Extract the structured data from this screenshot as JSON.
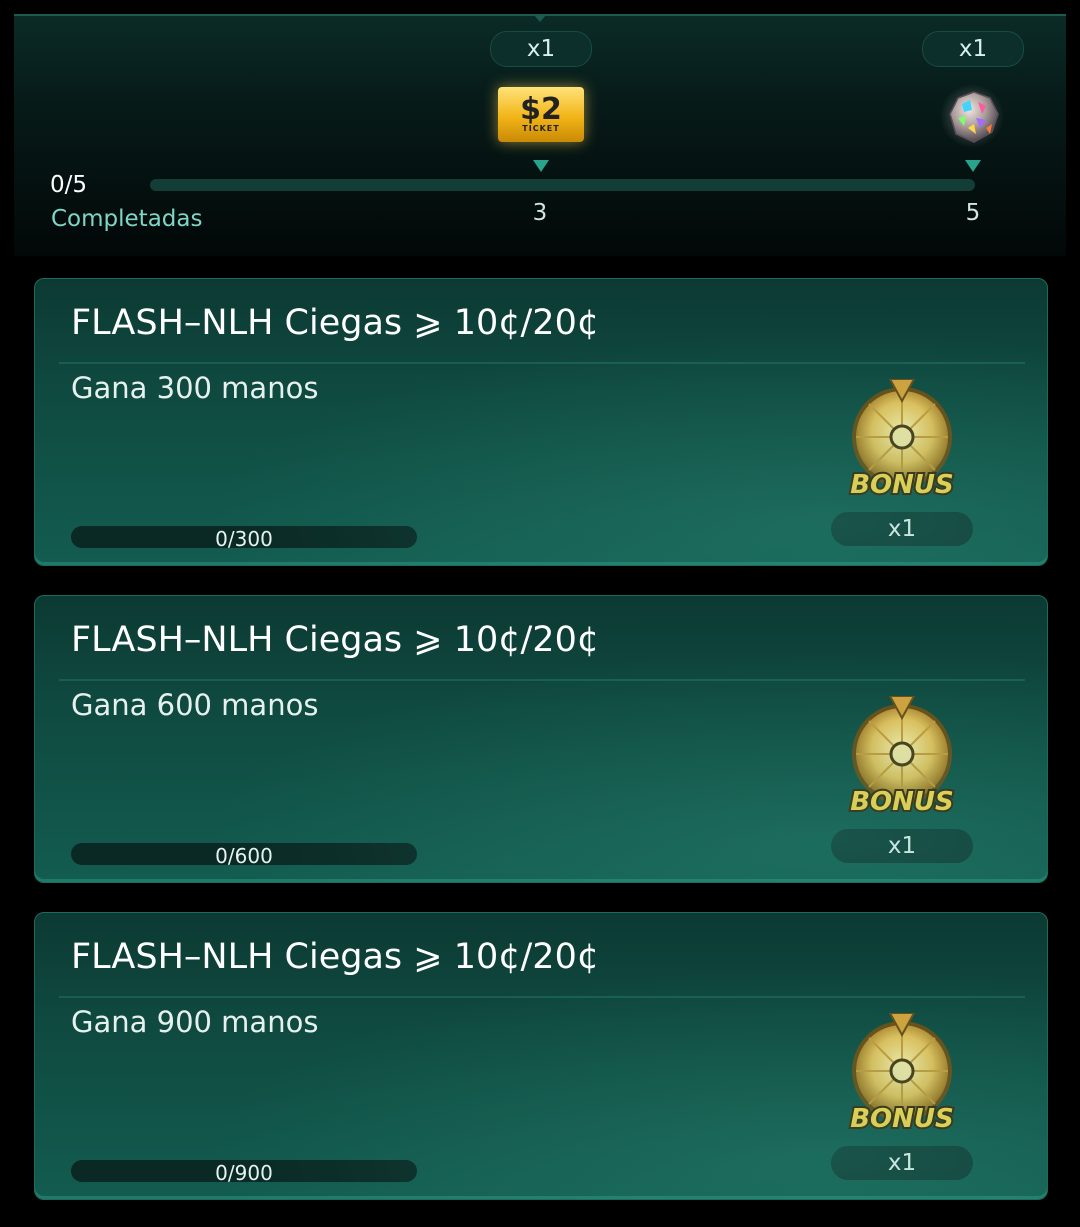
{
  "progress": {
    "count": "0/5",
    "label": "Completadas",
    "fraction": 0.0,
    "milestones": [
      {
        "multiplier": "x1",
        "step": "3",
        "reward_icon": "cash-ticket-icon",
        "ticket_amount": "$2",
        "ticket_caption": "TICKET"
      },
      {
        "multiplier": "x1",
        "step": "5",
        "reward_icon": "gem-stone-icon"
      }
    ]
  },
  "tasks": [
    {
      "title": "FLASH–NLH Ciegas ⩾ 10¢/20¢",
      "description": "Gana 300 manos",
      "progress_text": "0/300",
      "progress_fraction": 0,
      "reward_icon": "bonus-wheel-icon",
      "reward_label": "BONUS",
      "reward_multiplier": "x1"
    },
    {
      "title": "FLASH–NLH Ciegas ⩾ 10¢/20¢",
      "description": "Gana 600 manos",
      "progress_text": "0/600",
      "progress_fraction": 0,
      "reward_icon": "bonus-wheel-icon",
      "reward_label": "BONUS",
      "reward_multiplier": "x1"
    },
    {
      "title": "FLASH–NLH Ciegas ⩾ 10¢/20¢",
      "description": "Gana 900 manos",
      "progress_text": "0/900",
      "progress_fraction": 0,
      "reward_icon": "bonus-wheel-icon",
      "reward_label": "BONUS",
      "reward_multiplier": "x1"
    }
  ],
  "colors": {
    "accent": "#2bb89e",
    "label_teal": "#7fd6c6",
    "card_bg": "#0f4a40",
    "background": "#000000"
  }
}
